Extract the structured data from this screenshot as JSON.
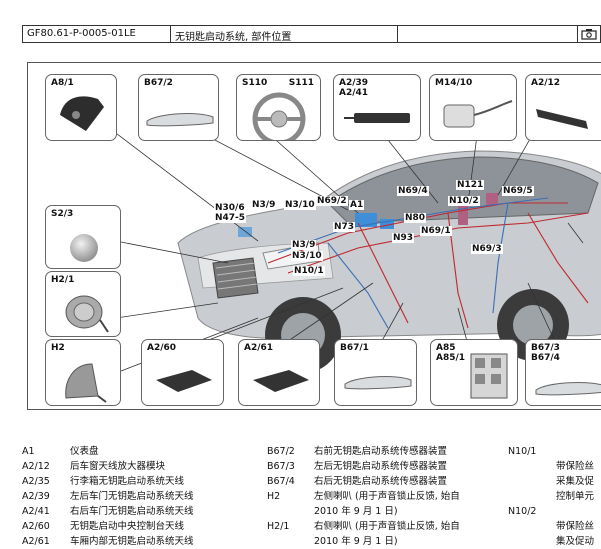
{
  "header": {
    "code": "GF80.61-P-0005-01LE",
    "title": "无钥匙启动系统, 部件位置"
  },
  "figure": {
    "boxes": {
      "a81": "A8/1",
      "b672_top": "B67/2",
      "s110": "S110",
      "s111": "S111",
      "a239_a241": "A2/39\nA2/41",
      "m1410": "M14/10",
      "a212": "A2/12",
      "s23": "S2/3",
      "h21": "H2/1",
      "h2": "H2",
      "a260": "A2/60",
      "a261": "A2/61",
      "b671": "B67/1",
      "a85_a851": "A85\nA85/1",
      "b673_b674": "B67/3\nB67/4"
    },
    "callouts": {
      "n306_n475": "N30/6\nN47-5",
      "n39_a": "N3/9",
      "n310_a": "N3/10",
      "n692": "N69/2",
      "a1": "A1",
      "n694": "N69/4",
      "n121": "N121",
      "n695": "N69/5",
      "n102": "N10/2",
      "n80": "N80",
      "n73": "N73",
      "n93": "N93",
      "n691": "N69/1",
      "n39_b": "N3/9",
      "n310_b": "N3/10",
      "n101": "N10/1",
      "n693": "N69/3"
    }
  },
  "legend": {
    "col1": [
      {
        "code": "A1",
        "desc": "仪表盘"
      },
      {
        "code": "A2/12",
        "desc": "后车窗天线放大器模块"
      },
      {
        "code": "A2/35",
        "desc": "行李箱无钥匙启动系统天线"
      },
      {
        "code": "A2/39",
        "desc": "左后车门无钥匙启动系统天线"
      },
      {
        "code": "A2/41",
        "desc": "右后车门无钥匙启动系统天线"
      },
      {
        "code": "A2/60",
        "desc": "无钥匙启动中央控制台天线"
      },
      {
        "code": "A2/61",
        "desc": "车厢内部无钥匙启动系统天线"
      }
    ],
    "col2": [
      {
        "code": "B67/2",
        "desc": "右前无钥匙启动系统传感器装置"
      },
      {
        "code": "B67/3",
        "desc": "左后无钥匙启动系统传感器装置"
      },
      {
        "code": "B67/4",
        "desc": "右后无钥匙启动系统传感器装置"
      },
      {
        "code": "H2",
        "desc": "左侧喇叭 (用于声音锁止反馈, 始自"
      },
      {
        "code": "",
        "desc": "2010 年 9 月 1 日)"
      },
      {
        "code": "H2/1",
        "desc": "右侧喇叭 (用于声音锁止反馈, 始自"
      },
      {
        "code": "",
        "desc": "2010 年 9 月 1 日)"
      }
    ],
    "col3": [
      {
        "code": "N10/1",
        "desc": ""
      },
      {
        "code": "",
        "desc": "带保险丝"
      },
      {
        "code": "",
        "desc": "采集及促"
      },
      {
        "code": "",
        "desc": "控制单元"
      },
      {
        "code": "N10/2",
        "desc": ""
      },
      {
        "code": "",
        "desc": "带保险丝"
      },
      {
        "code": "",
        "desc": "集及促动"
      }
    ]
  },
  "colors": {
    "wire_red": "#c0282f",
    "wire_blue": "#3a6fb5",
    "module_blue": "#3f8ed8",
    "box_border": "#666666"
  }
}
